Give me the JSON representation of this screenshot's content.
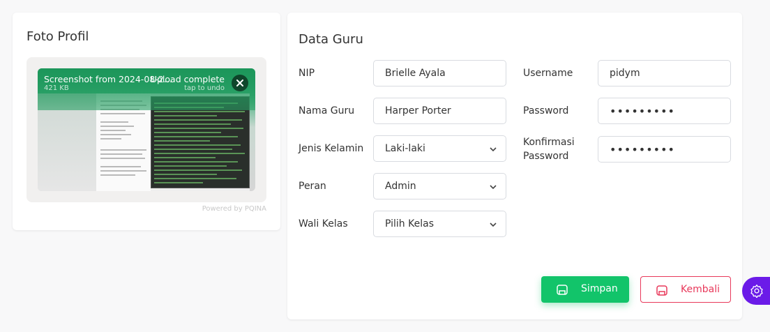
{
  "profile_card": {
    "title": "Foto Profil",
    "upload": {
      "file_name": "Screenshot from 2024-08-2…",
      "file_size": "421 KB",
      "status": "Upload complete",
      "status_hint": "tap to undo",
      "powered_by": "Powered by PQINA"
    }
  },
  "form_card": {
    "title": "Data Guru",
    "fields": {
      "nip": {
        "label": "NIP",
        "value": "Brielle Ayala"
      },
      "nama": {
        "label": "Nama Guru",
        "value": "Harper Porter"
      },
      "jenis_kelamin": {
        "label": "Jenis Kelamin",
        "value": "Laki-laki"
      },
      "peran": {
        "label": "Peran",
        "value": "Admin"
      },
      "wali_kelas": {
        "label": "Wali Kelas",
        "value": "Pilih Kelas"
      },
      "username": {
        "label": "Username",
        "value": "pidym"
      },
      "password": {
        "label": "Password",
        "value": "•••••••••"
      },
      "konfirmasi_1": {
        "label_line1": "Konfirmasi",
        "label_line2": "Password",
        "value": "•••••••••"
      }
    },
    "buttons": {
      "save": "Simpan",
      "back": "Kembali"
    }
  },
  "colors": {
    "save": "#12c46a",
    "back": "#e8385a",
    "fab": "#6b1be8"
  }
}
